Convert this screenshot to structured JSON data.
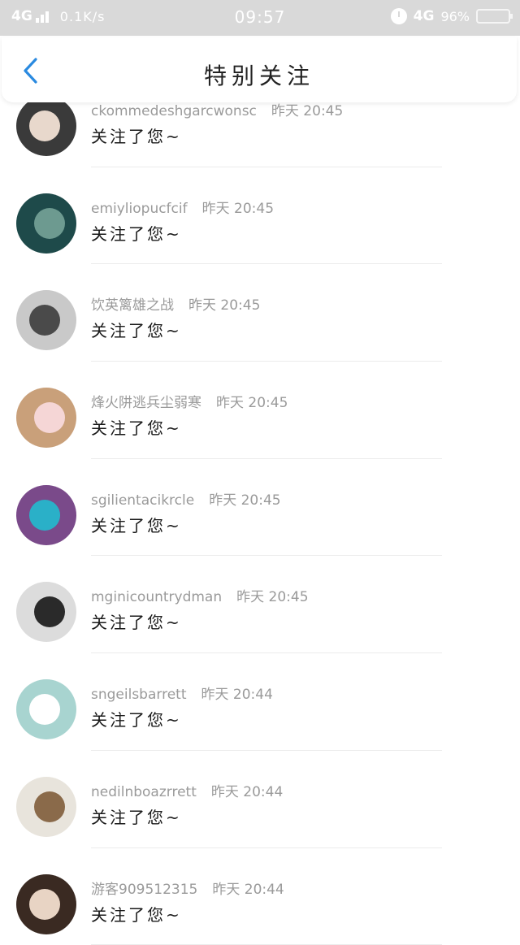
{
  "status_bar": {
    "network": "4G",
    "speed": "0.1K/s",
    "time": "09:57",
    "network_right": "4G",
    "battery": "96%"
  },
  "header": {
    "title": "特别关注",
    "back_icon": "chevron-left-icon",
    "accent_color": "#2a8ae0"
  },
  "items": [
    {
      "name": "ckommedeshgarcwonsc",
      "time": "昨天 20:45",
      "message": "关注了您~",
      "avatar_colors": [
        "#3a3a3a",
        "#e8d8cc"
      ]
    },
    {
      "name": "emiyliopucfcif",
      "time": "昨天 20:45",
      "message": "关注了您~",
      "avatar_colors": [
        "#1e4a4a",
        "#6d9a90"
      ]
    },
    {
      "name": "饮英篱雄之战",
      "time": "昨天 20:45",
      "message": "关注了您~",
      "avatar_colors": [
        "#c9c9c9",
        "#4a4a4a"
      ]
    },
    {
      "name": "烽火阱逃兵尘弱寒",
      "time": "昨天 20:45",
      "message": "关注了您~",
      "avatar_colors": [
        "#c9a07a",
        "#f5d6d6"
      ]
    },
    {
      "name": "sgilientacikrcle",
      "time": "昨天 20:45",
      "message": "关注了您~",
      "avatar_colors": [
        "#7a4a8a",
        "#2ab0c8"
      ]
    },
    {
      "name": "mginicountrydman",
      "time": "昨天 20:45",
      "message": "关注了您~",
      "avatar_colors": [
        "#dcdcdc",
        "#2a2a2a"
      ]
    },
    {
      "name": "sngeilsbarrett",
      "time": "昨天 20:44",
      "message": "关注了您~",
      "avatar_colors": [
        "#a8d4d0",
        "#ffffff"
      ]
    },
    {
      "name": "nedilnboazrrett",
      "time": "昨天 20:44",
      "message": "关注了您~",
      "avatar_colors": [
        "#e8e4dc",
        "#8a6a4a"
      ]
    },
    {
      "name": "游客909512315",
      "time": "昨天 20:44",
      "message": "关注了您~",
      "avatar_colors": [
        "#3a2a22",
        "#e8d4c4"
      ]
    }
  ]
}
